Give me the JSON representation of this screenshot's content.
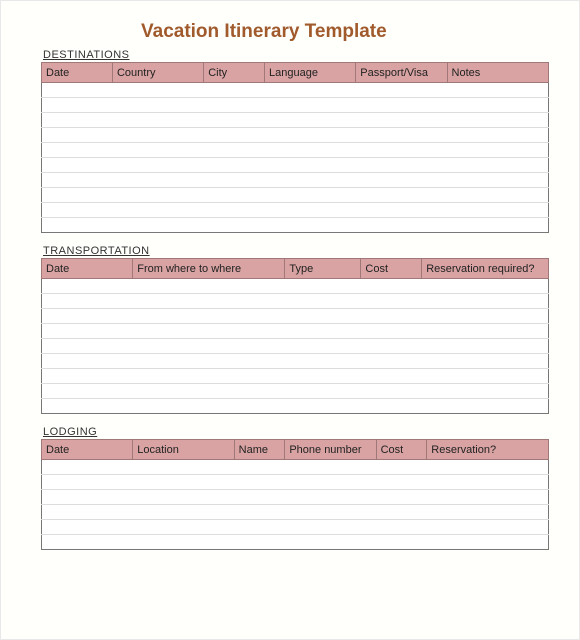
{
  "title": "Vacation Itinerary Template",
  "sections": {
    "destinations": {
      "label": "DESTINATIONS",
      "headers": [
        "Date",
        "Country",
        "City",
        "Language",
        "Passport/Visa",
        "Notes"
      ],
      "rows": [
        [
          "",
          "",
          "",
          "",
          "",
          ""
        ],
        [
          "",
          "",
          "",
          "",
          "",
          ""
        ],
        [
          "",
          "",
          "",
          "",
          "",
          ""
        ],
        [
          "",
          "",
          "",
          "",
          "",
          ""
        ],
        [
          "",
          "",
          "",
          "",
          "",
          ""
        ],
        [
          "",
          "",
          "",
          "",
          "",
          ""
        ],
        [
          "",
          "",
          "",
          "",
          "",
          ""
        ],
        [
          "",
          "",
          "",
          "",
          "",
          ""
        ],
        [
          "",
          "",
          "",
          "",
          "",
          ""
        ],
        [
          "",
          "",
          "",
          "",
          "",
          ""
        ]
      ],
      "widths": [
        14,
        18,
        12,
        18,
        18,
        20
      ]
    },
    "transportation": {
      "label": "TRANSPORTATION",
      "headers": [
        "Date",
        "From where to where",
        "Type",
        "Cost",
        "Reservation required?"
      ],
      "rows": [
        [
          "",
          "",
          "",
          "",
          ""
        ],
        [
          "",
          "",
          "",
          "",
          ""
        ],
        [
          "",
          "",
          "",
          "",
          ""
        ],
        [
          "",
          "",
          "",
          "",
          ""
        ],
        [
          "",
          "",
          "",
          "",
          ""
        ],
        [
          "",
          "",
          "",
          "",
          ""
        ],
        [
          "",
          "",
          "",
          "",
          ""
        ],
        [
          "",
          "",
          "",
          "",
          ""
        ],
        [
          "",
          "",
          "",
          "",
          ""
        ]
      ],
      "widths": [
        18,
        30,
        15,
        12,
        25
      ]
    },
    "lodging": {
      "label": "LODGING",
      "headers": [
        "Date",
        "Location",
        "Name",
        "Phone number",
        "Cost",
        "Reservation?"
      ],
      "rows": [
        [
          "",
          "",
          "",
          "",
          "",
          ""
        ],
        [
          "",
          "",
          "",
          "",
          "",
          ""
        ],
        [
          "",
          "",
          "",
          "",
          "",
          ""
        ],
        [
          "",
          "",
          "",
          "",
          "",
          ""
        ],
        [
          "",
          "",
          "",
          "",
          "",
          ""
        ],
        [
          "",
          "",
          "",
          "",
          "",
          ""
        ]
      ],
      "widths": [
        18,
        20,
        10,
        18,
        10,
        24
      ]
    }
  }
}
